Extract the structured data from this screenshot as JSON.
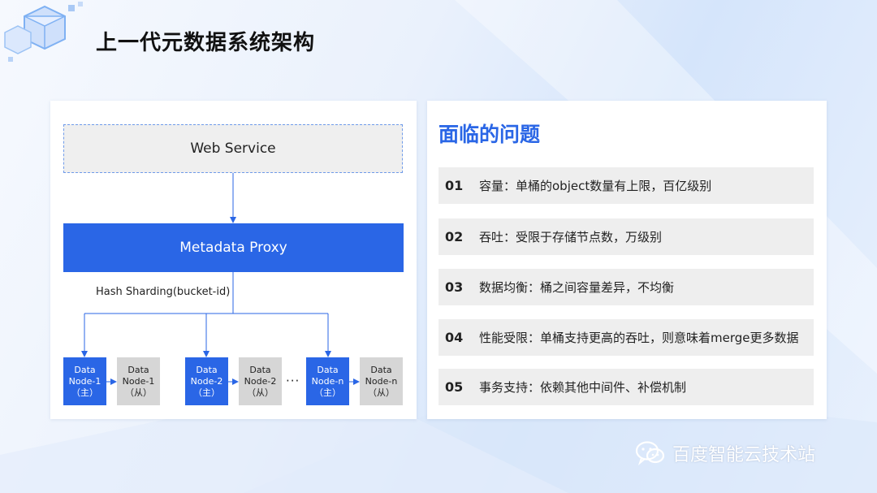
{
  "page": {
    "title": "上一代元数据系统架构"
  },
  "diagram": {
    "web_service": "Web Service",
    "metadata_proxy": "Metadata Proxy",
    "sharding_label": "Hash Sharding(bucket-id)",
    "ellipsis": "···",
    "nodes": [
      {
        "line1": "Data",
        "line2": "Node-1",
        "line3": "（主）"
      },
      {
        "line1": "Data",
        "line2": "Node-1",
        "line3": "（从）"
      },
      {
        "line1": "Data",
        "line2": "Node-2",
        "line3": "（主）"
      },
      {
        "line1": "Data",
        "line2": "Node-2",
        "line3": "（从）"
      },
      {
        "line1": "Data",
        "line2": "Node-n",
        "line3": "（主）"
      },
      {
        "line1": "Data",
        "line2": "Node-n",
        "line3": "（从）"
      }
    ]
  },
  "problems": {
    "title": "面临的问题",
    "items": [
      {
        "num": "01",
        "text": "容量：单桶的object数量有上限，百亿级别"
      },
      {
        "num": "02",
        "text": "吞吐：受限于存储节点数，万级别"
      },
      {
        "num": "03",
        "text": "数据均衡：桶之间容量差异，不均衡"
      },
      {
        "num": "04",
        "text": "性能受限：单桶支持更高的吞吐，则意味着merge更多数据"
      },
      {
        "num": "05",
        "text": "事务支持：依赖其他中间件、补偿机制"
      }
    ]
  },
  "watermark": {
    "text": "百度智能云技术站"
  },
  "colors": {
    "accent": "#2a66e6",
    "replica": "#d6d6d6",
    "panel": "#ffffff",
    "issue_bg": "#eeeeee"
  }
}
